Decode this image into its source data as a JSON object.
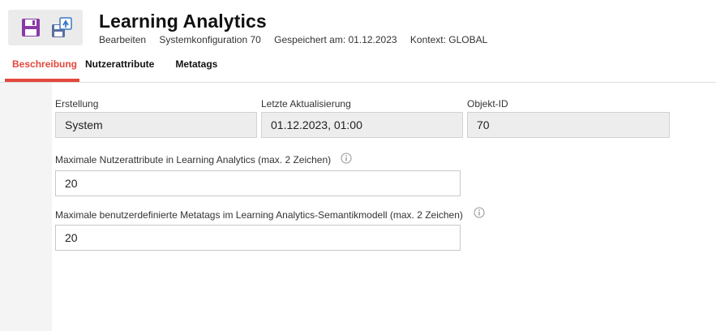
{
  "header": {
    "title": "Learning Analytics",
    "meta": {
      "action": "Bearbeiten",
      "config": "Systemkonfiguration 70",
      "saved": "Gespeichert am: 01.12.2023",
      "context": "Kontext: GLOBAL"
    }
  },
  "toolbar": {
    "buttons": [
      {
        "icon": "save-icon",
        "color": "#8a3aa8"
      },
      {
        "icon": "save-as-icon",
        "color": "#3a78c4"
      }
    ]
  },
  "tabs": [
    {
      "label": "Beschreibung",
      "active": true
    },
    {
      "label": "Nutzerattribute",
      "active": false
    },
    {
      "label": "Metatags",
      "active": false
    }
  ],
  "fields": {
    "erstellung": {
      "label": "Erstellung",
      "value": "System"
    },
    "aktualisierung": {
      "label": "Letzte Aktualisierung",
      "value": "01.12.2023, 01:00"
    },
    "objekt_id": {
      "label": "Objekt-ID",
      "value": "70"
    },
    "max_attr": {
      "label": "Maximale Nutzerattribute in Learning Analytics (max. 2 Zeichen)",
      "value": "20"
    },
    "max_tags": {
      "label": "Maximale benutzerdefinierte Metatags im Learning Analytics-Semantikmodell (max. 2 Zeichen)",
      "value": "20"
    }
  },
  "colors": {
    "accent": "#e3473b",
    "readonly_bg": "#ededed"
  }
}
